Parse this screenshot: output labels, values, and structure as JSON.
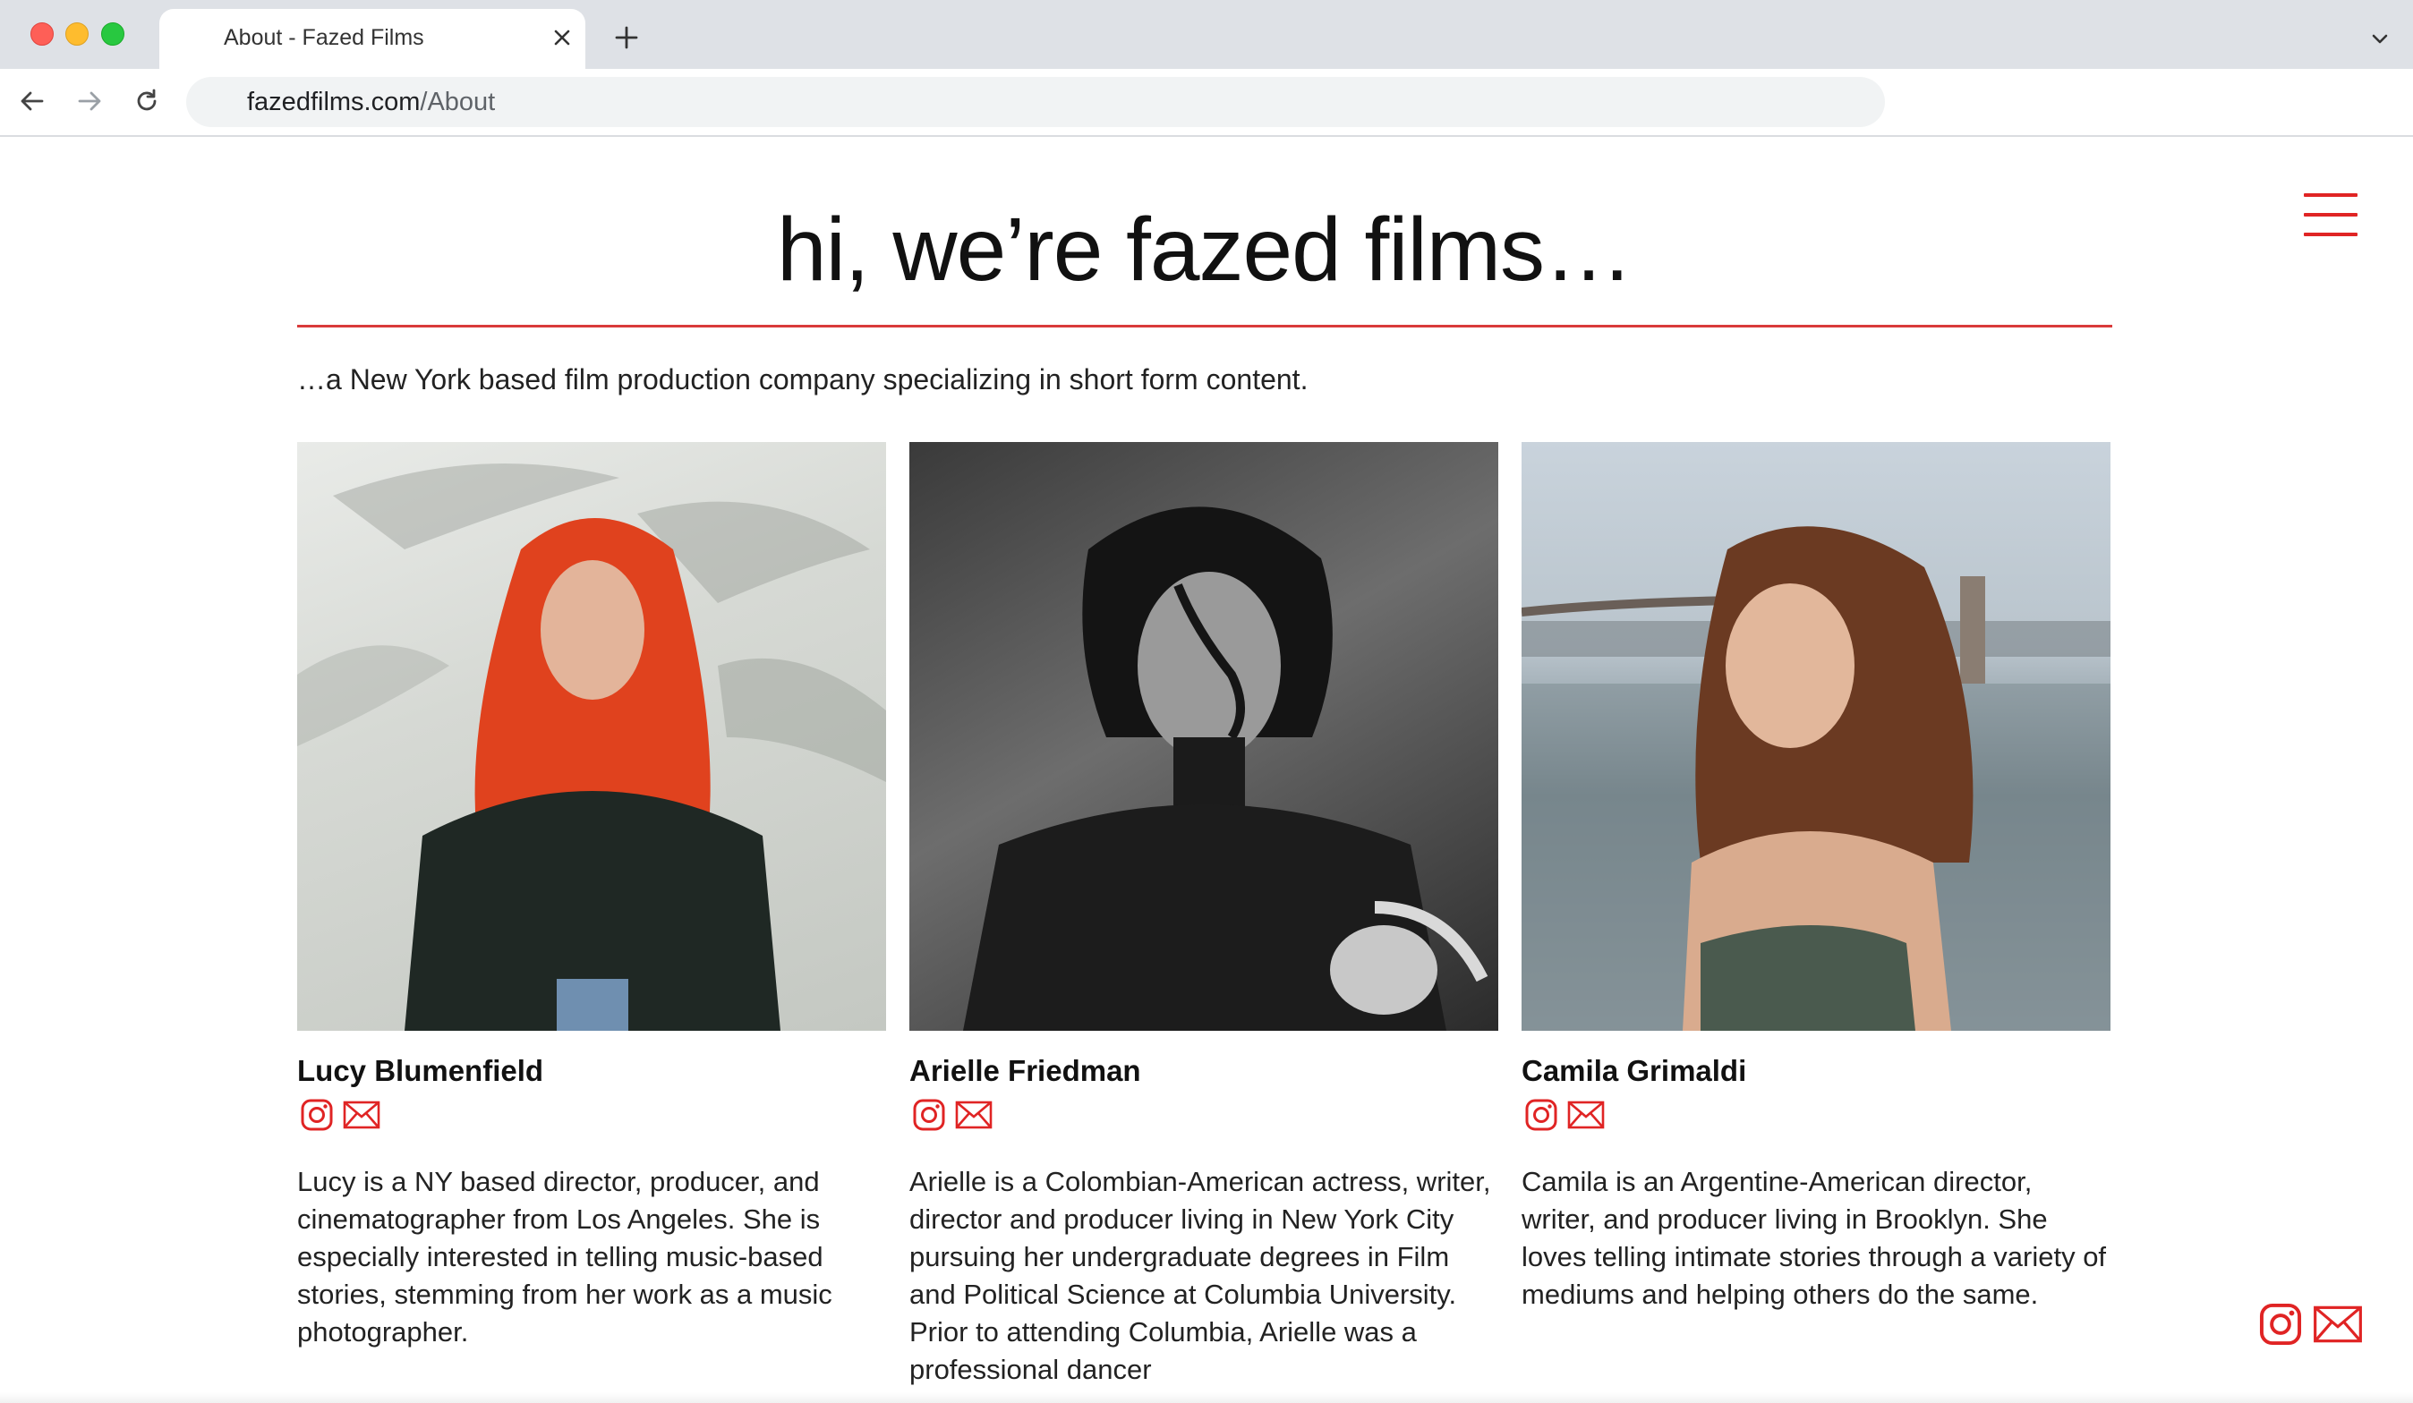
{
  "browser": {
    "tab_title": "About - Fazed Films",
    "url_host": "fazedfilms.com",
    "url_path": "/About"
  },
  "page": {
    "headline": "hi, we’re fazed films…",
    "tagline": "…a New York based film production company specializing in short form content.",
    "accent_color": "#e02424"
  },
  "team": [
    {
      "name": "Lucy Blumenfield",
      "bio": "Lucy is a NY based director, producer, and cinematographer from Los Angeles. She is especially interested in telling music-based stories, stemming from her work as a music photographer."
    },
    {
      "name": "Arielle Friedman",
      "bio": "Arielle is a Colombian-American actress, writer, director and producer living in New York City pursuing her undergraduate degrees in Film and Political Science at Columbia University. Prior to attending Columbia, Arielle was a professional dancer"
    },
    {
      "name": "Camila Grimaldi",
      "bio": "Camila is an Argentine-American director, writer, and producer living in Brooklyn. She loves telling intimate stories through a variety of mediums and helping others do the same."
    }
  ],
  "icons": {
    "instagram": "instagram-icon",
    "email": "envelope-icon",
    "menu": "hamburger-menu-icon"
  }
}
